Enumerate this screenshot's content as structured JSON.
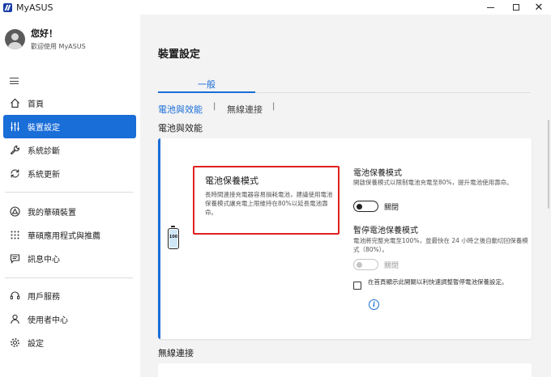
{
  "window": {
    "title": "MyASUS",
    "minimize": "",
    "maximize": "",
    "close": "✕"
  },
  "user": {
    "greeting": "您好！",
    "welcome": "歡迎使用 MyASUS"
  },
  "sidebar": {
    "items": [
      {
        "label": "首頁",
        "icon": "home-icon"
      },
      {
        "label": "裝置設定",
        "icon": "sliders-icon"
      },
      {
        "label": "系統診斷",
        "icon": "wrench-icon"
      },
      {
        "label": "系統更新",
        "icon": "update-icon"
      },
      {
        "label": "我的華碩裝置",
        "icon": "triangle-icon"
      },
      {
        "label": "華碩應用程式與推薦",
        "icon": "apps-grid-icon"
      },
      {
        "label": "訊息中心",
        "icon": "message-icon"
      },
      {
        "label": "用戶服務",
        "icon": "headset-icon"
      },
      {
        "label": "使用者中心",
        "icon": "person-icon"
      },
      {
        "label": "設定",
        "icon": "gear-icon"
      }
    ]
  },
  "main": {
    "title": "裝置設定",
    "tab": "一般",
    "subtabs": [
      "電池與效能",
      "無線連接"
    ],
    "subtab_separator": "|",
    "section_title": "電池與效能",
    "battery_icon_text": "100",
    "card": {
      "title": "電池保養模式",
      "description": "長時間連接充電器容易損耗電池，建議使用電池保養模式讓充電上限維持在80%以延長電池壽命。",
      "option1": {
        "title": "電池保養模式",
        "description": "開啟保養模式以限制電池充電至80%，提升電池使用壽命。",
        "toggle_label": "關閉"
      },
      "option2": {
        "title": "暫停電池保養模式",
        "description": "電池將完整充電至100%，並最快在 24 小時之後自動切回保養模式（80%）。",
        "toggle_label": "關閉"
      },
      "checkbox_label": "在首頁顯示此開關以利快速調整暫停電池保養設定。",
      "info_icon": "i"
    },
    "section2_title": "無線連接"
  },
  "colors": {
    "accent": "#1a6ed8",
    "highlight_border": "#e0211f"
  }
}
